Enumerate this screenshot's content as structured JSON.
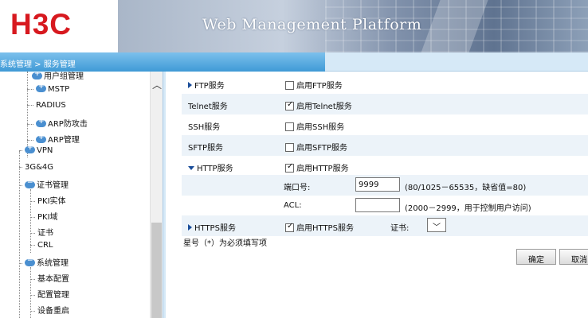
{
  "header": {
    "logo": "H3C",
    "title": "Web Management Platform"
  },
  "breadcrumb": "系统管理 > 服务管理",
  "sidebar": {
    "items": [
      {
        "label": "用户组管理",
        "icon": "folder-closed-icon"
      },
      {
        "label": "MSTP",
        "icon": "folder-closed-icon"
      },
      {
        "label": "RADIUS",
        "icon": ""
      },
      {
        "label": "ARP防攻击",
        "icon": "folder-closed-icon"
      },
      {
        "label": "ARP管理",
        "icon": "folder-closed-icon"
      },
      {
        "label": "VPN",
        "icon": "folder-closed-icon"
      },
      {
        "label": "3G&4G",
        "icon": ""
      },
      {
        "label": "证书管理",
        "icon": "folder-open-icon"
      },
      {
        "label": "PKI实体",
        "icon": ""
      },
      {
        "label": "PKI域",
        "icon": ""
      },
      {
        "label": "证书",
        "icon": ""
      },
      {
        "label": "CRL",
        "icon": ""
      },
      {
        "label": "系统管理",
        "icon": "folder-open-icon"
      },
      {
        "label": "基本配置",
        "icon": ""
      },
      {
        "label": "配置管理",
        "icon": ""
      },
      {
        "label": "设备重启",
        "icon": ""
      }
    ]
  },
  "services": {
    "ftp": {
      "label": "FTP服务",
      "checkbox_label": "启用FTP服务",
      "checked": false
    },
    "telnet": {
      "label": "Telnet服务",
      "checkbox_label": "启用Telnet服务",
      "checked": true
    },
    "ssh": {
      "label": "SSH服务",
      "checkbox_label": "启用SSH服务",
      "checked": false
    },
    "sftp": {
      "label": "SFTP服务",
      "checkbox_label": "启用SFTP服务",
      "checked": false
    },
    "http": {
      "label": "HTTP服务",
      "checkbox_label": "启用HTTP服务",
      "checked": true,
      "port_label": "端口号:",
      "port_value": "9999",
      "port_hint": "(80/1025－65535，缺省值=80)",
      "acl_label": "ACL:",
      "acl_value": "",
      "acl_hint": "(2000－2999，用于控制用户访问)"
    },
    "https": {
      "label": "HTTPS服务",
      "checkbox_label": "启用HTTPS服务",
      "checked": true,
      "cert_label": "证书:",
      "cert_value": ""
    }
  },
  "note": "星号（*）为必须填写项",
  "buttons": {
    "confirm": "确定",
    "cancel": "取消"
  },
  "colors": {
    "brand_red": "#d7191f",
    "breadcrumb_blue": "#3f9ad6",
    "row_alt": "#ecf3f9"
  }
}
